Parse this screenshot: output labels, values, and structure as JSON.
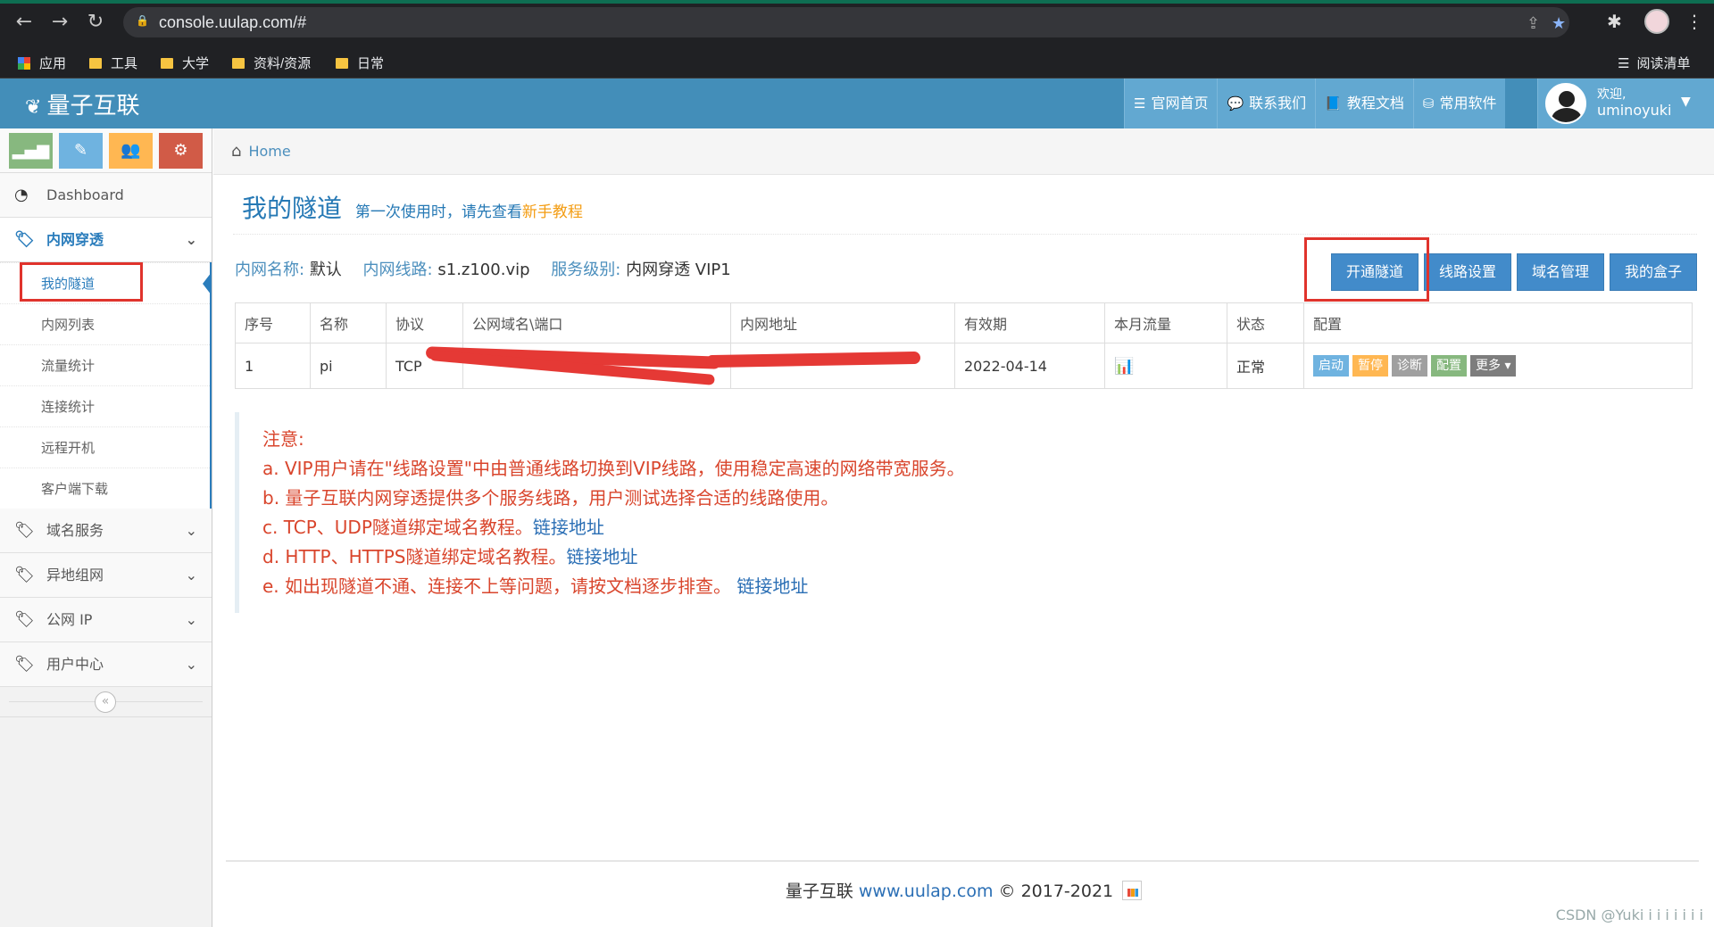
{
  "browser": {
    "url": "console.uulap.com/#",
    "bookmarks": [
      "应用",
      "工具",
      "大学",
      "资料/资源",
      "日常"
    ],
    "reading_list": "阅读清单"
  },
  "header": {
    "brand": "量子互联",
    "nav": [
      "官网首页",
      "联系我们",
      "教程文档",
      "常用软件"
    ],
    "welcome": "欢迎,",
    "username": "uminoyuki"
  },
  "sidebar": {
    "dashboard": "Dashboard",
    "intranet": "内网穿透",
    "intranet_items": [
      "我的隧道",
      "内网列表",
      "流量统计",
      "连接统计",
      "远程开机",
      "客户端下载"
    ],
    "domain_service": "域名服务",
    "remote_network": "异地组网",
    "public_ip": "公网 IP",
    "user_center": "用户中心",
    "collapse_glyph": "«"
  },
  "breadcrumb": "Home",
  "page": {
    "title": "我的隧道",
    "subtitle_a": "第一次使用时，请先查看",
    "subtitle_b": "新手教程"
  },
  "info": {
    "name_label": "内网名称:",
    "name_value": "默认",
    "line_label": "内网线路:",
    "line_value": "s1.z100.vip",
    "level_label": "服务级别:",
    "level_value": "内网穿透 VIP1"
  },
  "actions": [
    "开通隧道",
    "线路设置",
    "域名管理",
    "我的盒子"
  ],
  "table": {
    "headers": [
      "序号",
      "名称",
      "协议",
      "公网域名\\端口",
      "内网地址",
      "有效期",
      "本月流量",
      "状态",
      "配置"
    ],
    "row": {
      "index": "1",
      "name": "pi",
      "protocol": "TCP",
      "expiry": "2022-04-14",
      "status": "正常",
      "buttons": [
        "启动",
        "暂停",
        "诊断",
        "配置",
        "更多"
      ]
    }
  },
  "notice": {
    "title": "注意:",
    "a": "a. VIP用户请在\"线路设置\"中由普通线路切换到VIP线路，使用稳定高速的网络带宽服务。",
    "b": "b. 量子互联内网穿透提供多个服务线路，用户测试选择合适的线路使用。",
    "c": "c. TCP、UDP隧道绑定域名教程。",
    "d": "d. HTTP、HTTPS隧道绑定域名教程。",
    "e": "e. 如出现隧道不通、连接不上等问题，请按文档逐步排查。",
    "link": "链接地址"
  },
  "footer": {
    "brand": "量子互联",
    "site": "www.uulap.com",
    "copyright": "© 2017-2021"
  },
  "watermark": "CSDN @Yuki i i i i i i i",
  "colors": {
    "header_bg": "#438eb9",
    "accent_blue": "#2b7dbc",
    "primary_button": "#428bca",
    "notice_text": "#d9452c",
    "highlight_box": "#e0332c"
  }
}
